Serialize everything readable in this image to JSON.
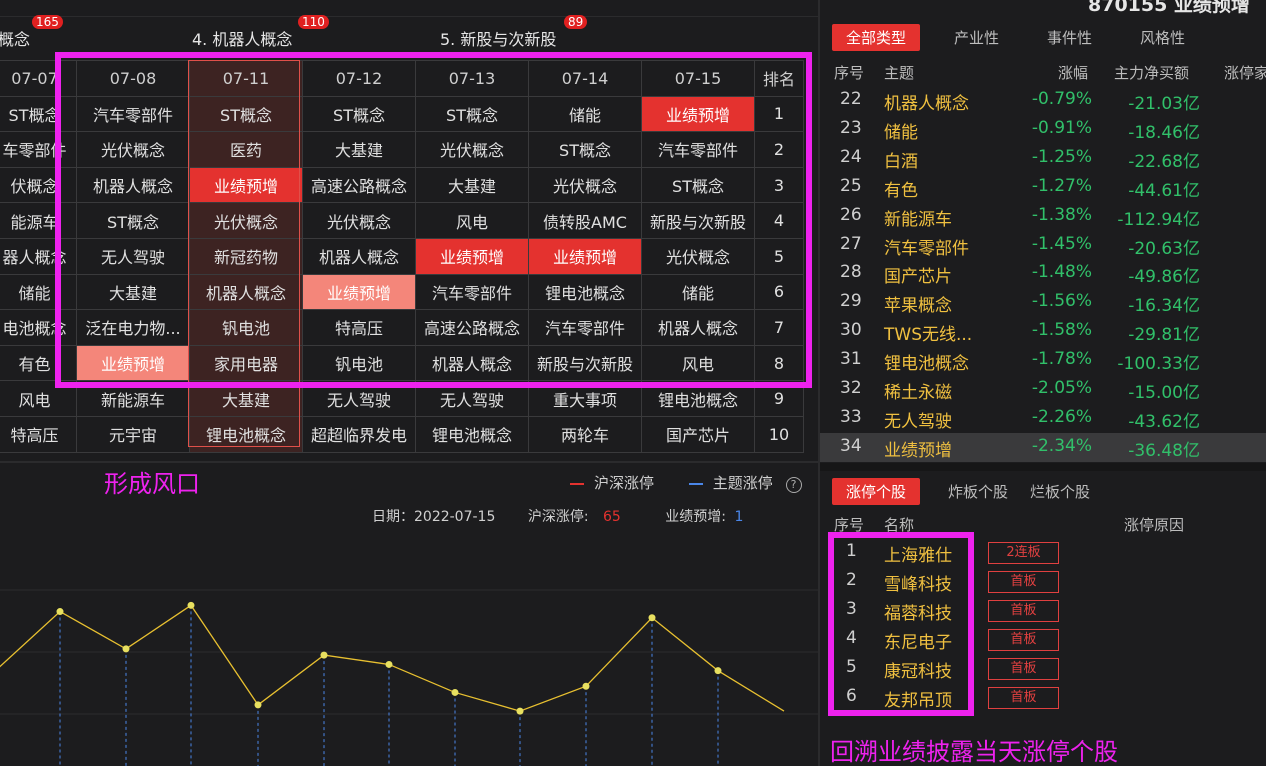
{
  "hot_themes": [
    {
      "label": "概念",
      "count": "165"
    },
    {
      "label": "4. 机器人概念",
      "count": "110"
    },
    {
      "label": "5. 新股与次新股",
      "count": "89"
    }
  ],
  "grid": {
    "headers": [
      "07-07",
      "07-08",
      "07-11",
      "07-12",
      "07-13",
      "07-14",
      "07-15",
      "排名"
    ],
    "rows": [
      [
        "ST概念",
        "汽车零部件",
        "ST概念",
        "ST概念",
        "ST概念",
        "储能",
        "业绩预增",
        "1"
      ],
      [
        "车零部件",
        "光伏概念",
        "医药",
        "大基建",
        "光伏概念",
        "ST概念",
        "汽车零部件",
        "2"
      ],
      [
        "伏概念",
        "机器人概念",
        "业绩预增",
        "高速公路概念",
        "大基建",
        "光伏概念",
        "ST概念",
        "3"
      ],
      [
        "能源车",
        "ST概念",
        "光伏概念",
        "光伏概念",
        "风电",
        "债转股AMC",
        "新股与次新股",
        "4"
      ],
      [
        "器人概念",
        "无人驾驶",
        "新冠药物",
        "机器人概念",
        "业绩预增",
        "业绩预增",
        "光伏概念",
        "5"
      ],
      [
        "储能",
        "大基建",
        "机器人概念",
        "业绩预增",
        "汽车零部件",
        "锂电池概念",
        "储能",
        "6"
      ],
      [
        "电池概念",
        "泛在电力物...",
        "钒电池",
        "特高压",
        "高速公路概念",
        "汽车零部件",
        "机器人概念",
        "7"
      ],
      [
        "有色",
        "业绩预增",
        "家用电器",
        "钒电池",
        "机器人概念",
        "新股与次新股",
        "风电",
        "8"
      ],
      [
        "风电",
        "新能源车",
        "大基建",
        "无人驾驶",
        "无人驾驶",
        "重大事项",
        "锂电池概念",
        "9"
      ],
      [
        "特高压",
        "元宇宙",
        "锂电池概念",
        "超超临界发电",
        "锂电池概念",
        "两轮车",
        "国产芯片",
        "10"
      ]
    ]
  },
  "caption_left": "形成风口",
  "legend": {
    "series1": "沪深涨停",
    "series2": "主题涨停",
    "help": "?"
  },
  "info": {
    "date_label": "日期：2022-07-15",
    "hs_label": "沪深涨停:",
    "hs_value": "65",
    "theme_label": "业绩预增:",
    "theme_value": "1"
  },
  "chart_data": {
    "type": "line",
    "note_series": "主题涨停 (yellow line, partial view)",
    "points": [
      20,
      40,
      28,
      42,
      10,
      26,
      23,
      14,
      8,
      16,
      38,
      21,
      8
    ]
  },
  "right_title": "870155 业绩预增",
  "type_tabs": [
    "全部类型",
    "产业性",
    "事件性",
    "风格性"
  ],
  "theme_headers": {
    "idx": "序号",
    "name": "主题",
    "pct": "涨幅",
    "flow": "主力净买额",
    "extra": "涨停家"
  },
  "themes": [
    {
      "idx": "22",
      "name": "机器人概念",
      "pct": "-0.79%",
      "flow": "-21.03亿"
    },
    {
      "idx": "23",
      "name": "储能",
      "pct": "-0.91%",
      "flow": "-18.46亿"
    },
    {
      "idx": "24",
      "name": "白酒",
      "pct": "-1.25%",
      "flow": "-22.68亿"
    },
    {
      "idx": "25",
      "name": "有色",
      "pct": "-1.27%",
      "flow": "-44.61亿"
    },
    {
      "idx": "26",
      "name": "新能源车",
      "pct": "-1.38%",
      "flow": "-112.94亿"
    },
    {
      "idx": "27",
      "name": "汽车零部件",
      "pct": "-1.45%",
      "flow": "-20.63亿"
    },
    {
      "idx": "28",
      "name": "国产芯片",
      "pct": "-1.48%",
      "flow": "-49.86亿"
    },
    {
      "idx": "29",
      "name": "苹果概念",
      "pct": "-1.56%",
      "flow": "-16.34亿"
    },
    {
      "idx": "30",
      "name": "TWS无线...",
      "pct": "-1.58%",
      "flow": "-29.81亿"
    },
    {
      "idx": "31",
      "name": "锂电池概念",
      "pct": "-1.78%",
      "flow": "-100.33亿"
    },
    {
      "idx": "32",
      "name": "稀土永磁",
      "pct": "-2.05%",
      "flow": "-15.00亿"
    },
    {
      "idx": "33",
      "name": "无人驾驶",
      "pct": "-2.26%",
      "flow": "-43.62亿"
    },
    {
      "idx": "34",
      "name": "业绩预增",
      "pct": "-2.34%",
      "flow": "-36.48亿"
    }
  ],
  "stock_tabs": [
    "涨停个股",
    "炸板个股",
    "烂板个股"
  ],
  "stock_headers": {
    "idx": "序号",
    "name": "名称",
    "reason": "涨停原因"
  },
  "stocks": [
    {
      "idx": "1",
      "name": "上海雅仕",
      "tag": "2连板"
    },
    {
      "idx": "2",
      "name": "雪峰科技",
      "tag": "首板"
    },
    {
      "idx": "3",
      "name": "福蓉科技",
      "tag": "首板"
    },
    {
      "idx": "4",
      "name": "东尼电子",
      "tag": "首板"
    },
    {
      "idx": "5",
      "name": "康冠科技",
      "tag": "首板"
    },
    {
      "idx": "6",
      "name": "友邦吊顶",
      "tag": "首板"
    }
  ],
  "caption_right": "回溯业绩披露当天涨停个股",
  "colors": {
    "up_red": "#e4322f",
    "down_green": "#31c06a",
    "name_gold": "#f0c040",
    "annotation_magenta": "#ee22ee"
  }
}
